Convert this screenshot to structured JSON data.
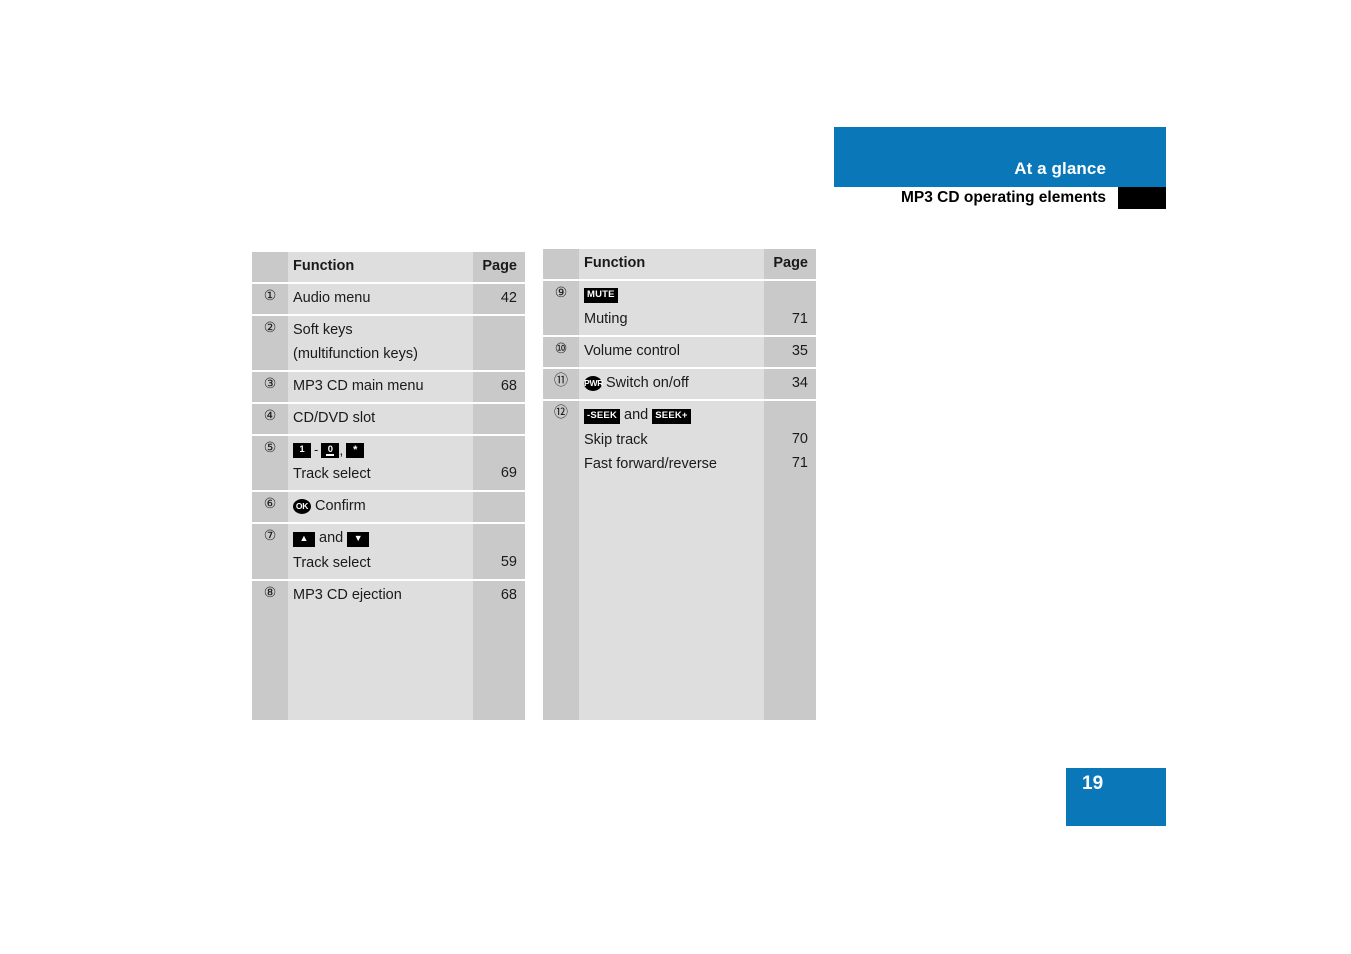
{
  "header": {
    "band_title": "At a glance",
    "sub_title": "MP3 CD operating elements"
  },
  "page_badge": {
    "number": "19"
  },
  "tables": {
    "left": {
      "head": {
        "function": "Function",
        "page": "Page"
      },
      "rows": [
        {
          "num": "①",
          "function": "Audio menu",
          "page": "42"
        },
        {
          "num": "②",
          "function": "Soft keys",
          "function2": "(multifunction keys)",
          "page": ""
        },
        {
          "num": "③",
          "function": "MP3 CD main menu",
          "page": "68"
        },
        {
          "num": "④",
          "function": "CD/DVD slot",
          "page": ""
        },
        {
          "num": "⑤",
          "icons": "digit-keys",
          "key_1": "1",
          "key_0": "0",
          "key_star": "*",
          "dash": "-",
          "comma": ",",
          "function2": "Track select",
          "page": "69"
        },
        {
          "num": "⑥",
          "icons": "ok-key",
          "key_ok": "OK",
          "function": "Confirm",
          "page": ""
        },
        {
          "num": "⑦",
          "icons": "arrow-keys",
          "key_up": "▲",
          "key_down": "▼",
          "joiner": "and",
          "function2": "Track select",
          "page": "59"
        },
        {
          "num": "⑧",
          "function": "MP3 CD ejection",
          "page": "68"
        }
      ]
    },
    "right": {
      "head": {
        "function": "Function",
        "page": "Page"
      },
      "rows": [
        {
          "num": "⑨",
          "icons": "mute-key",
          "key_mute": "MUTE",
          "function2": "Muting",
          "page": "71"
        },
        {
          "num": "⑩",
          "function": "Volume control",
          "page": "35"
        },
        {
          "num": "⑪",
          "icons": "pwr-key",
          "key_pwr": "PWR",
          "function": "Switch on/off",
          "page": "34"
        },
        {
          "num": "⑫",
          "icons": "seek-keys",
          "key_seek_minus": "-SEEK",
          "key_seek_plus": "SEEK+",
          "joiner": "and",
          "function2": "Skip track",
          "page2": "70",
          "function3": "Fast forward/reverse",
          "page3": "71"
        }
      ]
    }
  },
  "colors": {
    "brand_blue": "#0a78b8",
    "table_shade_dark": "#c9c9c9",
    "table_shade_light": "#dedede",
    "black": "#000000"
  }
}
